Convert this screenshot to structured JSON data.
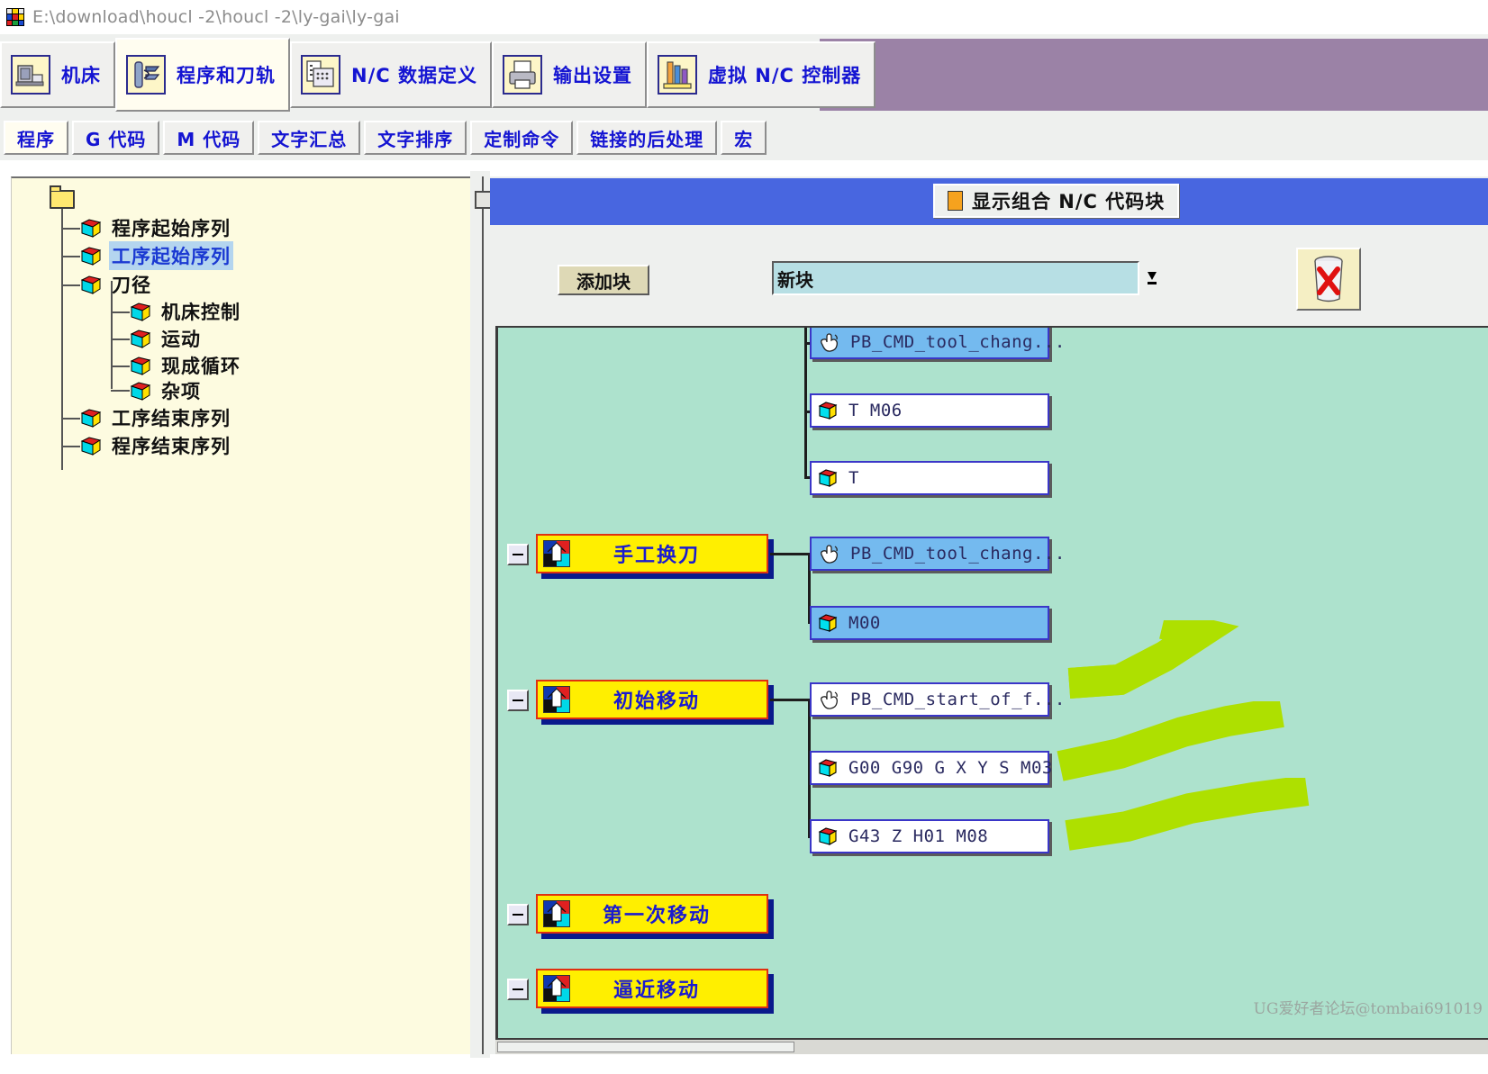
{
  "window": {
    "title": "E:\\download\\houcl -2\\houcl -2\\ly-gai\\ly-gai",
    "icon": "app-cube-icon"
  },
  "main_tabs": [
    {
      "label": "机床",
      "icon": "machine-icon",
      "active": false
    },
    {
      "label": "程序和刀轨",
      "icon": "program-toolpath-icon",
      "active": true
    },
    {
      "label": "N/C 数据定义",
      "icon": "nc-data-icon",
      "active": false
    },
    {
      "label": "输出设置",
      "icon": "printer-icon",
      "active": false
    },
    {
      "label": "虚拟 N/C 控制器",
      "icon": "virtual-nc-icon",
      "active": false
    }
  ],
  "sub_tabs": [
    {
      "label": "程序",
      "active": true
    },
    {
      "label": "G 代码",
      "active": false
    },
    {
      "label": "M 代码",
      "active": false
    },
    {
      "label": "文字汇总",
      "active": false
    },
    {
      "label": "文字排序",
      "active": false
    },
    {
      "label": "定制命令",
      "active": false
    },
    {
      "label": "链接的后处理",
      "active": false
    },
    {
      "label": "宏",
      "active": false
    }
  ],
  "tree": {
    "root_icon": "folder-icon",
    "items": [
      {
        "label": "程序起始序列",
        "depth": 1,
        "selected": false,
        "icon": "cube-icon"
      },
      {
        "label": "工序起始序列",
        "depth": 1,
        "selected": true,
        "icon": "cube-icon"
      },
      {
        "label": "刀径",
        "depth": 1,
        "selected": false,
        "icon": "cube-icon"
      },
      {
        "label": "机床控制",
        "depth": 2,
        "selected": false,
        "icon": "cube-icon"
      },
      {
        "label": "运动",
        "depth": 2,
        "selected": false,
        "icon": "cube-icon"
      },
      {
        "label": "现成循环",
        "depth": 2,
        "selected": false,
        "icon": "cube-icon"
      },
      {
        "label": "杂项",
        "depth": 2,
        "selected": false,
        "icon": "cube-icon"
      },
      {
        "label": "工序结束序列",
        "depth": 1,
        "selected": false,
        "icon": "cube-icon"
      },
      {
        "label": "程序结束序列",
        "depth": 1,
        "selected": false,
        "icon": "cube-icon"
      }
    ]
  },
  "right_panel": {
    "header": {
      "title": "显示组合 N/C 代码块",
      "marker_icon": "orange-square-icon"
    },
    "toolbar": {
      "add_block_label": "添加块",
      "combo_value": "新块",
      "combo_arrow_icon": "chevron-down-icon",
      "delete_icon": "trash-delete-icon"
    },
    "blocks": [
      {
        "id": "b1",
        "label": "PB_CMD_tool_chang...",
        "type": "command",
        "selected": true,
        "icon": "hand-pointer-icon"
      },
      {
        "id": "b2",
        "label": "T M06",
        "type": "code",
        "selected": false,
        "icon": "cube-icon"
      },
      {
        "id": "b3",
        "label": "T",
        "type": "code",
        "selected": false,
        "icon": "cube-icon"
      }
    ],
    "groups": [
      {
        "id": "g1",
        "label": "手工换刀",
        "icon": "puzzle-icon",
        "collapse_icon": "collapse-minus-icon",
        "children": [
          {
            "label": "PB_CMD_tool_chang...",
            "type": "command",
            "selected": true,
            "icon": "hand-pointer-icon"
          },
          {
            "label": "M00",
            "type": "code",
            "selected": true,
            "icon": "cube-icon"
          }
        ]
      },
      {
        "id": "g2",
        "label": "初始移动",
        "icon": "puzzle-icon",
        "collapse_icon": "collapse-minus-icon",
        "children": [
          {
            "label": "PB_CMD_start_of_f...",
            "type": "command",
            "selected": false,
            "icon": "hand-pointer-icon"
          },
          {
            "label": "G00 G90 G X Y S M03",
            "type": "code",
            "selected": false,
            "icon": "cube-icon"
          },
          {
            "label": "G43 Z H01 M08",
            "type": "code",
            "selected": false,
            "icon": "cube-icon"
          }
        ]
      },
      {
        "id": "g3",
        "label": "第一次移动",
        "icon": "puzzle-icon",
        "collapse_icon": "collapse-minus-icon",
        "children": []
      },
      {
        "id": "g4",
        "label": "逼近移动",
        "icon": "puzzle-icon",
        "collapse_icon": "collapse-minus-icon",
        "children": []
      }
    ],
    "annotations": {
      "count": 3,
      "color": "#aee000",
      "shape": "highlighter-stroke"
    }
  },
  "watermark": "UG爱好者论坛@tombai691019",
  "colors": {
    "canvas_bg": "#ade2cd",
    "header_bar": "#4866e0",
    "group_fill": "#ffef00",
    "group_border": "#e03010",
    "group_shadow": "#0a1a8c",
    "selected_item": "#74baef",
    "tab_text": "#1414d2",
    "left_panel_bg": "#fdfbe0",
    "purple_fill": "#9b82a6",
    "marker": "#aee000"
  }
}
